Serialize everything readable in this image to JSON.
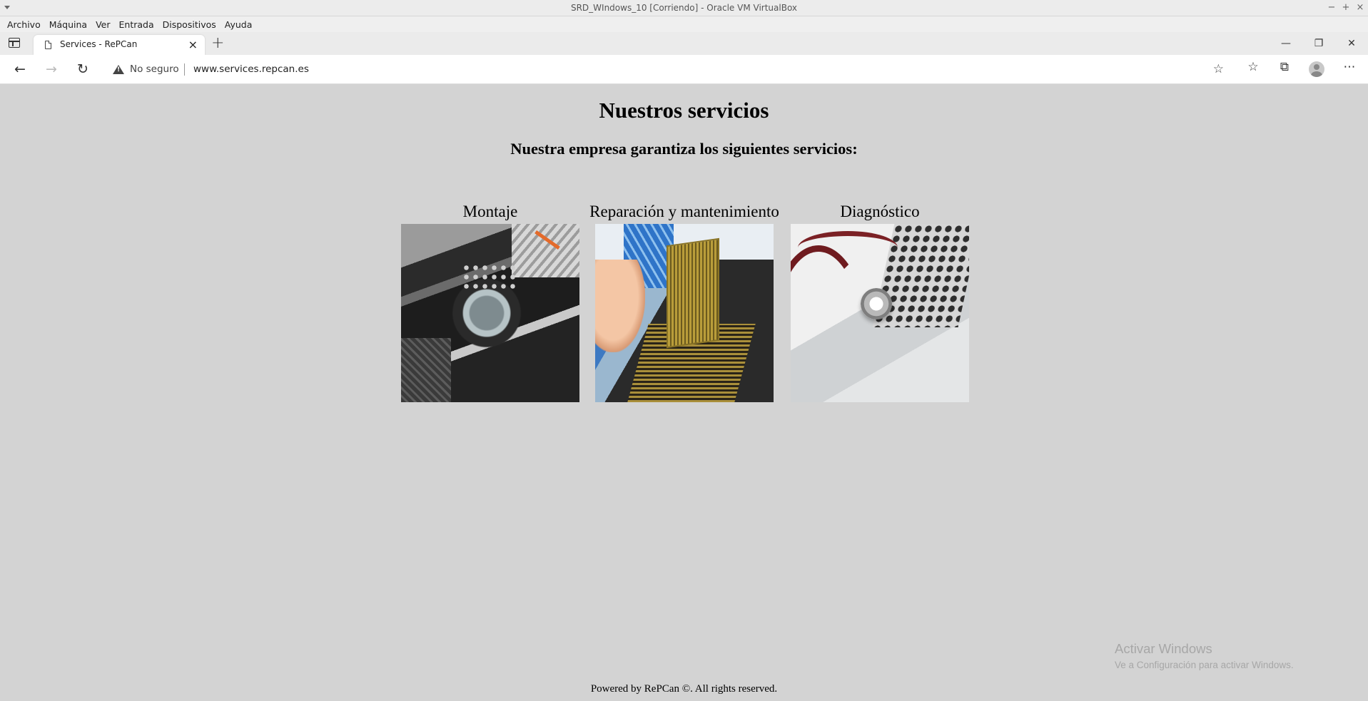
{
  "vm_window": {
    "title": "SRD_WIndows_10 [Corriendo] - Oracle VM VirtualBox",
    "controls": [
      "−",
      "+",
      "×"
    ]
  },
  "vm_menu": [
    "Archivo",
    "Máquina",
    "Ver",
    "Entrada",
    "Dispositivos",
    "Ayuda"
  ],
  "browser": {
    "tab_title": "Services - RePCan",
    "tab_close": "×",
    "new_tab": "+",
    "window_controls": [
      "—",
      "❐",
      "✕"
    ],
    "security_label": "No seguro",
    "url": "www.services.repcan.es",
    "icons": {
      "back": "←",
      "forward": "→",
      "refresh": "↻",
      "add_favorite": "☆",
      "favorites": "☆",
      "collections": "⧉",
      "more": "⋯"
    }
  },
  "page": {
    "heading": "Nuestros servicios",
    "subheading": "Nuestra empresa garantiza los siguientes servicios:",
    "services": [
      {
        "label": "Montaje",
        "image": "motherboard-image"
      },
      {
        "label": "Reparación y mantenimiento",
        "image": "cpu-repair-image"
      },
      {
        "label": "Diagnóstico",
        "image": "stethoscope-laptop-image"
      }
    ],
    "footer": "Powered by RePCan ©. All rights reserved."
  },
  "watermark": {
    "line1": "Activar Windows",
    "line2": "Ve a Configuración para activar Windows."
  }
}
